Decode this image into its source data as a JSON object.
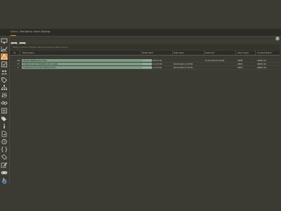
{
  "tabs": [
    {
      "label": "Alarms",
      "active": true
    },
    {
      "label": "Test Alarms",
      "active": false
    },
    {
      "label": "Alarm Settings",
      "active": false
    }
  ],
  "group_hint": "Drag a column header here to group by that column",
  "grid": {
    "columns": [
      "ID",
      "Explanation",
      "Date Start",
      "Date Seen",
      "Date End",
      "Alarm Type",
      "Contact Name"
    ],
    "rows": [
      {
        "id": "215",
        "explanation": "BOTEZ MIRZES DISC MAN",
        "date_start": "21.05.2024 08:07:00",
        "date_seen": "",
        "date_end": "21.05.2024 10:19:00",
        "alarm_type": "UBHE",
        "contact_name": "UBHE 115"
      },
      {
        "id": "8",
        "explanation": "FURNACE UNIT TEMPERATURE ALARM",
        "date_start": "09.03.2022 11:07:58",
        "date_seen": "09.03.2022 11:07:58",
        "date_end": "",
        "alarm_type": "UBTO",
        "contact_name": "UBHE 116"
      },
      {
        "id": "7",
        "explanation": "FURNACE/CYCLE WIRE BREAK FAULT",
        "date_start": "09.03.2022 11:07:54",
        "date_seen": "09.03.2022 11:07:54",
        "date_end": "",
        "alarm_type": "UBTO",
        "contact_name": "UBHE 116"
      }
    ]
  },
  "colors": {
    "accent": "#e3923a",
    "selection": "#7d9e86",
    "background": "#3b3b33"
  }
}
